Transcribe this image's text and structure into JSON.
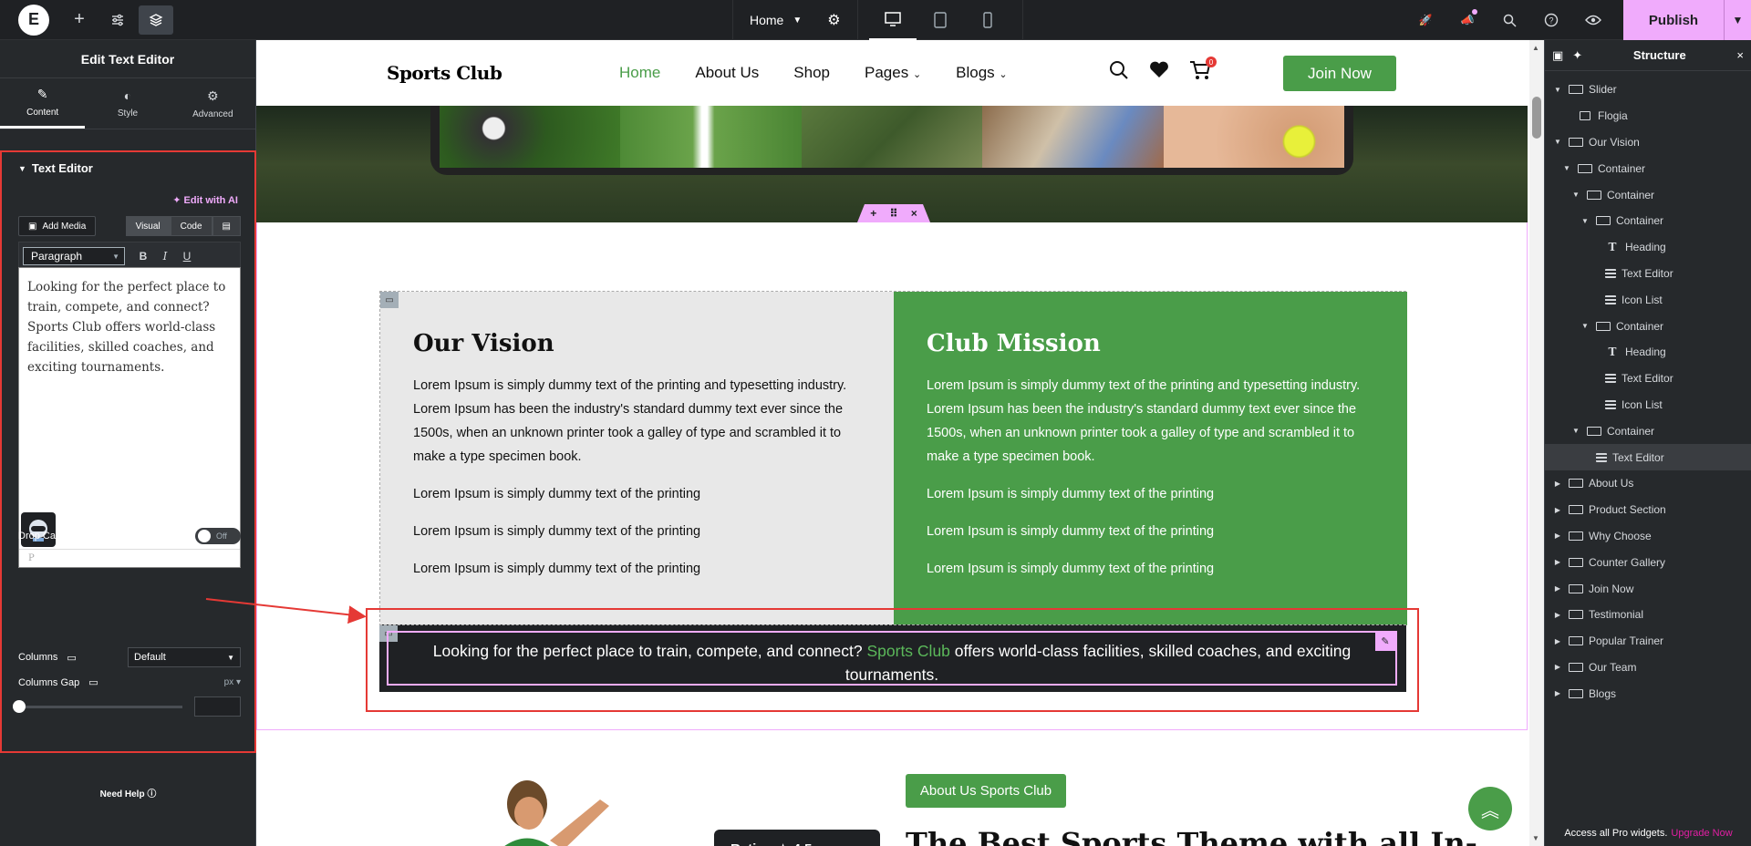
{
  "topbar": {
    "page_name": "Home",
    "publish_label": "Publish"
  },
  "panel": {
    "title": "Edit Text Editor",
    "tabs": [
      {
        "label": "Content"
      },
      {
        "label": "Style"
      },
      {
        "label": "Advanced"
      }
    ],
    "section_title": "Text Editor",
    "edit_ai_label": "Edit with AI",
    "add_media_label": "Add Media",
    "visual_label": "Visual",
    "code_label": "Code",
    "format_value": "Paragraph",
    "editor_text": "Looking for the perfect place to train, compete, and connect? Sports Club offers world-class facilities, skilled coaches, and exciting tournaments.",
    "editor_status": "P",
    "drop_cap_label": "Drop Cap",
    "drop_cap_state": "Off",
    "columns_label": "Columns",
    "columns_value": "Default",
    "columns_gap_label": "Columns Gap",
    "columns_gap_unit": "px",
    "need_help_label": "Need Help"
  },
  "site": {
    "logo": "Sports Club",
    "nav": [
      "Home",
      "About Us",
      "Shop",
      "Pages",
      "Blogs"
    ],
    "cart_count": "0",
    "join_label": "Join Now",
    "vision": {
      "title": "Our Vision",
      "body": "Lorem Ipsum is simply dummy text of the printing and typesetting industry. Lorem Ipsum has been the industry's standard dummy text ever since the 1500s, when an unknown printer took a galley of type and scrambled it to make a type specimen book.",
      "items": [
        "Lorem Ipsum is simply dummy text of the printing",
        "Lorem Ipsum is simply dummy text of the printing",
        "Lorem Ipsum is simply dummy text of the printing"
      ]
    },
    "mission": {
      "title": "Club Mission",
      "body": "Lorem Ipsum is simply dummy text of the printing and typesetting industry. Lorem Ipsum has been the industry's standard dummy text ever since the 1500s, when an unknown printer took a galley of type and scrambled it to make a type specimen book.",
      "items": [
        "Lorem Ipsum is simply dummy text of the printing",
        "Lorem Ipsum is simply dummy text of the printing",
        "Lorem Ipsum is simply dummy text of the printing"
      ]
    },
    "text_block": {
      "before": "Looking for the perfect place to train, compete, and connect? ",
      "highlight": "Sports Club",
      "after": " offers world-class facilities, skilled coaches, and exciting tournaments."
    },
    "about_pill": "About Us Sports Club",
    "big_title": "The Best Sports Theme with all In-",
    "rating_text": "Rating ★ 4.5"
  },
  "structure": {
    "title": "Structure",
    "nodes": [
      {
        "label": "Slider",
        "depth": 0,
        "expanded": true,
        "icon": "container"
      },
      {
        "label": "Flogia",
        "depth": 1,
        "expanded": null,
        "icon": "widget"
      },
      {
        "label": "Our Vision",
        "depth": 0,
        "expanded": true,
        "icon": "container"
      },
      {
        "label": "Container",
        "depth": 1,
        "expanded": true,
        "icon": "container"
      },
      {
        "label": "Container",
        "depth": 2,
        "expanded": true,
        "icon": "container"
      },
      {
        "label": "Container",
        "depth": 3,
        "expanded": true,
        "icon": "container"
      },
      {
        "label": "Heading",
        "depth": 4,
        "expanded": null,
        "icon": "heading"
      },
      {
        "label": "Text Editor",
        "depth": 4,
        "expanded": null,
        "icon": "text"
      },
      {
        "label": "Icon List",
        "depth": 4,
        "expanded": null,
        "icon": "list"
      },
      {
        "label": "Container",
        "depth": 3,
        "expanded": true,
        "icon": "container"
      },
      {
        "label": "Heading",
        "depth": 4,
        "expanded": null,
        "icon": "heading"
      },
      {
        "label": "Text Editor",
        "depth": 4,
        "expanded": null,
        "icon": "text"
      },
      {
        "label": "Icon List",
        "depth": 4,
        "expanded": null,
        "icon": "list"
      },
      {
        "label": "Container",
        "depth": 2,
        "expanded": true,
        "icon": "container"
      },
      {
        "label": "Text Editor",
        "depth": 3,
        "expanded": null,
        "icon": "text",
        "selected": true
      },
      {
        "label": "About Us",
        "depth": 0,
        "expanded": false,
        "icon": "container"
      },
      {
        "label": "Product Section",
        "depth": 0,
        "expanded": false,
        "icon": "container"
      },
      {
        "label": "Why Choose",
        "depth": 0,
        "expanded": false,
        "icon": "container"
      },
      {
        "label": "Counter Gallery",
        "depth": 0,
        "expanded": false,
        "icon": "container"
      },
      {
        "label": "Join Now",
        "depth": 0,
        "expanded": false,
        "icon": "container"
      },
      {
        "label": "Testimonial",
        "depth": 0,
        "expanded": false,
        "icon": "container"
      },
      {
        "label": "Popular Trainer",
        "depth": 0,
        "expanded": false,
        "icon": "container"
      },
      {
        "label": "Our Team",
        "depth": 0,
        "expanded": false,
        "icon": "container"
      },
      {
        "label": "Blogs",
        "depth": 0,
        "expanded": false,
        "icon": "container"
      }
    ],
    "promo_text": "Access all Pro widgets.",
    "promo_link": "Upgrade Now"
  },
  "colors": {
    "accent_pink": "#f0abfc",
    "brand_green": "#4a9d49",
    "annotation_red": "#e53935"
  }
}
